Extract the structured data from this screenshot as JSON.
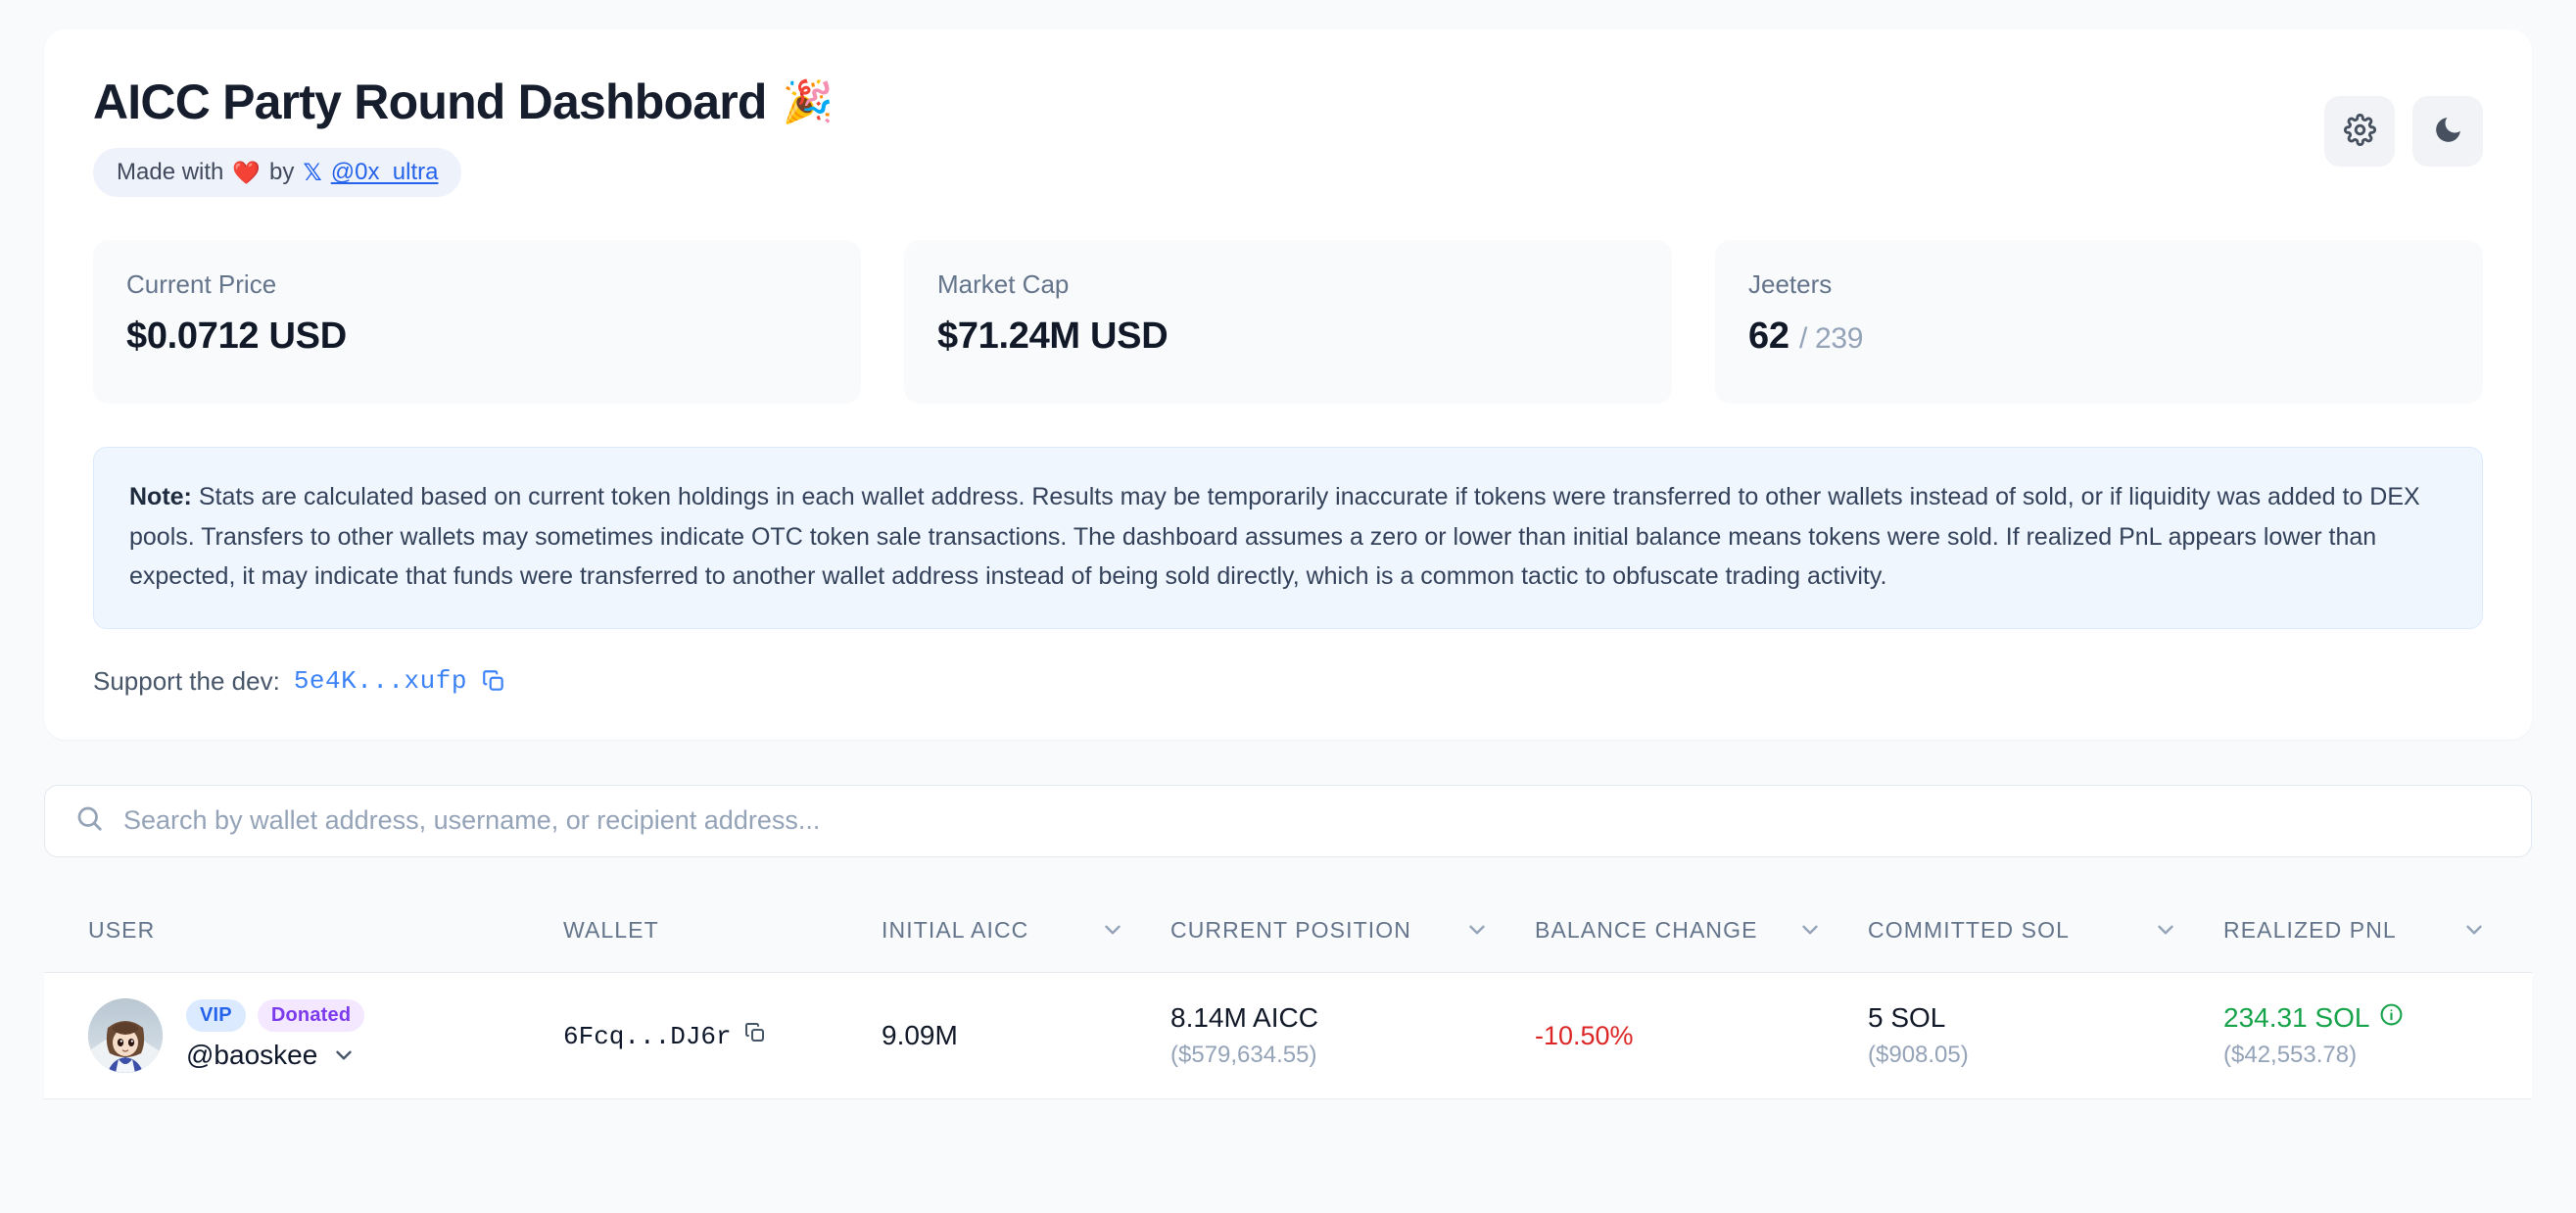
{
  "header": {
    "title": "AICC Party Round Dashboard",
    "title_emoji": "🎉",
    "made_prefix": "Made with",
    "heart": "❤️",
    "made_by": "by",
    "x_logo": "𝕏",
    "handle": "@0x_ultra",
    "settings_icon": "gear-icon",
    "theme_icon": "moon-icon"
  },
  "stats": [
    {
      "label": "Current Price",
      "value": "$0.0712 USD",
      "muted": ""
    },
    {
      "label": "Market Cap",
      "value": "$71.24M USD",
      "muted": ""
    },
    {
      "label": "Jeeters",
      "value": "62",
      "muted": "/ 239"
    }
  ],
  "note": {
    "prefix": "Note:",
    "body": " Stats are calculated based on current token holdings in each wallet address. Results may be temporarily inaccurate if tokens were transferred to other wallets instead of sold, or if liquidity was added to DEX pools. Transfers to other wallets may sometimes indicate OTC token sale transactions. The dashboard assumes a zero or lower than initial balance means tokens were sold. If realized PnL appears lower than expected, it may indicate that funds were transferred to another wallet address instead of being sold directly, which is a common tactic to obfuscate trading activity."
  },
  "support": {
    "label": "Support the dev:",
    "address": "5e4K...xufp",
    "copy_icon": "copy-icon"
  },
  "search": {
    "placeholder": "Search by wallet address, username, or recipient address...",
    "value": "",
    "icon": "search-icon"
  },
  "table": {
    "columns": [
      {
        "label": "USER",
        "sortable": false
      },
      {
        "label": "WALLET",
        "sortable": false
      },
      {
        "label": "INITIAL AICC",
        "sortable": true
      },
      {
        "label": "CURRENT POSITION",
        "sortable": true
      },
      {
        "label": "BALANCE CHANGE",
        "sortable": true
      },
      {
        "label": "COMMITTED SOL",
        "sortable": true
      },
      {
        "label": "REALIZED PNL",
        "sortable": true
      }
    ],
    "rows": [
      {
        "badges": [
          "VIP",
          "Donated"
        ],
        "username": "@baoskee",
        "wallet": "6Fcq...DJ6r",
        "initial_aicc": "9.09M",
        "current_position": "8.14M AICC",
        "current_position_usd": "($579,634.55)",
        "balance_change": "-10.50%",
        "committed_sol": "5 SOL",
        "committed_sol_usd": "($908.05)",
        "realized_pnl": "234.31 SOL",
        "realized_pnl_usd": "($42,553.78)"
      }
    ]
  },
  "colors": {
    "accent_blue": "#2563eb",
    "link_blue": "#3b82f6",
    "negative_red": "#dc2626",
    "positive_green": "#16a34a",
    "badge_vip_text": "#2563eb",
    "badge_donated_text": "#7c3aed",
    "page_bg": "#f8fafc",
    "note_bg": "#eff6fd"
  }
}
